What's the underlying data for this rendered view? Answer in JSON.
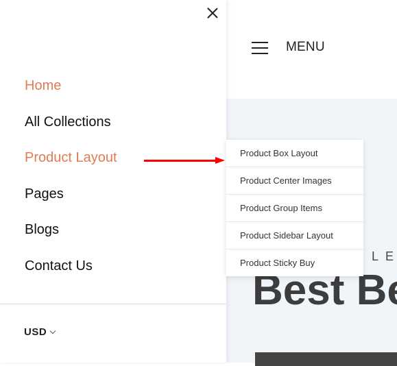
{
  "header": {
    "menu_label": "MENU"
  },
  "hero": {
    "subtitle": "LE",
    "title": "Best Be"
  },
  "drawer": {
    "nav": [
      {
        "label": "Home",
        "active": true
      },
      {
        "label": "All Collections",
        "active": false
      },
      {
        "label": "Product Layout",
        "active": true
      },
      {
        "label": "Pages",
        "active": false
      },
      {
        "label": "Blogs",
        "active": false
      },
      {
        "label": "Contact Us",
        "active": false
      }
    ],
    "currency": "USD"
  },
  "submenu": {
    "items": [
      "Product Box Layout",
      "Product Center Images",
      "Product Group Items",
      "Product Sidebar Layout",
      "Product Sticky Buy"
    ]
  },
  "colors": {
    "accent": "#e07b53",
    "annotation_arrow": "#ff0000",
    "hero_bg": "#f0f5f9"
  }
}
